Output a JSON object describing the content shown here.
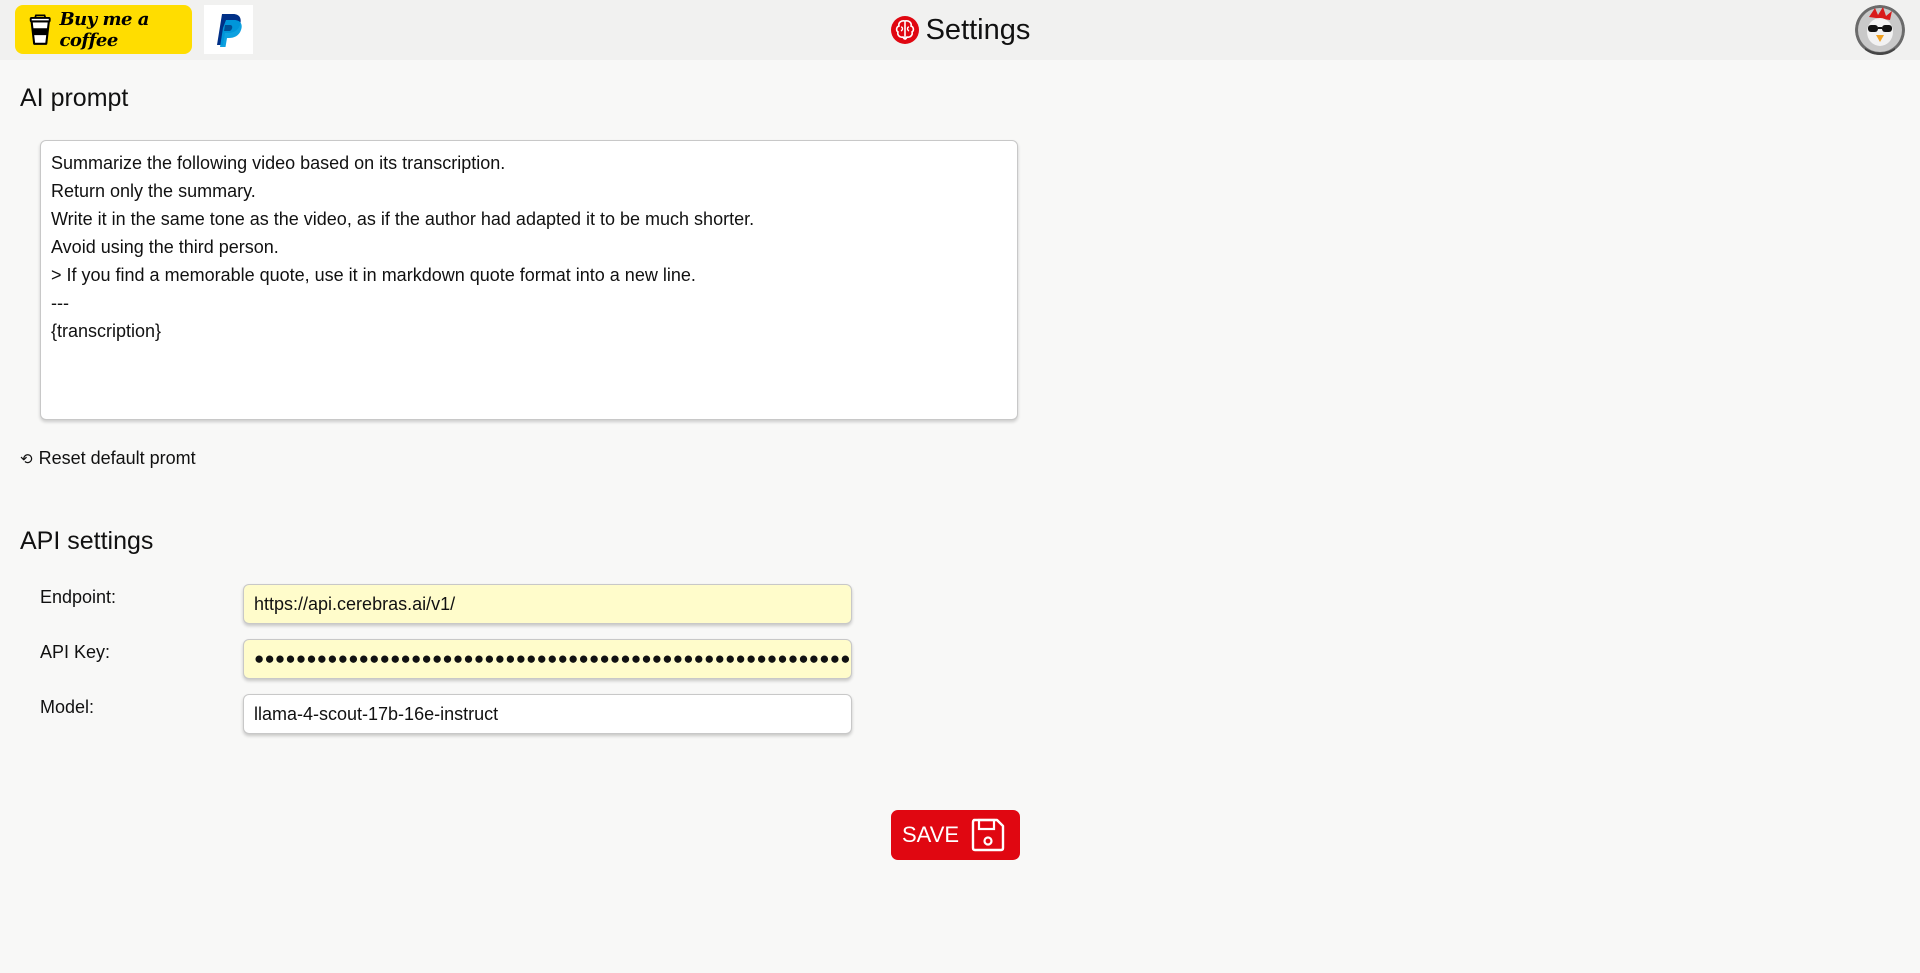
{
  "header": {
    "donate_coffee_label": "Buy me a coffee",
    "title": "Settings",
    "colors": {
      "coffee_bg": "#ffdd00",
      "brand_red": "#e00711"
    }
  },
  "prompt_section": {
    "heading": "AI prompt",
    "prompt_text": "Summarize the following video based on its transcription.\nReturn only the summary.\nWrite it in the same tone as the video, as if the author had adapted it to be much shorter.\nAvoid using the third person.\n> If you find a memorable quote, use it in markdown quote format into a new line.\n---\n{transcription}",
    "reset_label": "Reset default promt"
  },
  "api_section": {
    "heading": "API settings",
    "endpoint_label": "Endpoint:",
    "endpoint_value": "https://api.cerebras.ai/v1/",
    "api_key_label": "API Key:",
    "api_key_masked": "●●●●●●●●●●●●●●●●●●●●●●●●●●●●●●●●●●●●●●●●●●●●●●●●●●●●●●●●●",
    "model_label": "Model:",
    "model_value": "llama-4-scout-17b-16e-instruct"
  },
  "actions": {
    "save_label": "SAVE"
  },
  "icons": {
    "coffee": "coffee-cup-icon",
    "paypal": "paypal-icon",
    "title": "brain-icon",
    "avatar": "avatar",
    "reset": "reset-icon",
    "save": "floppy-disk-icon"
  }
}
